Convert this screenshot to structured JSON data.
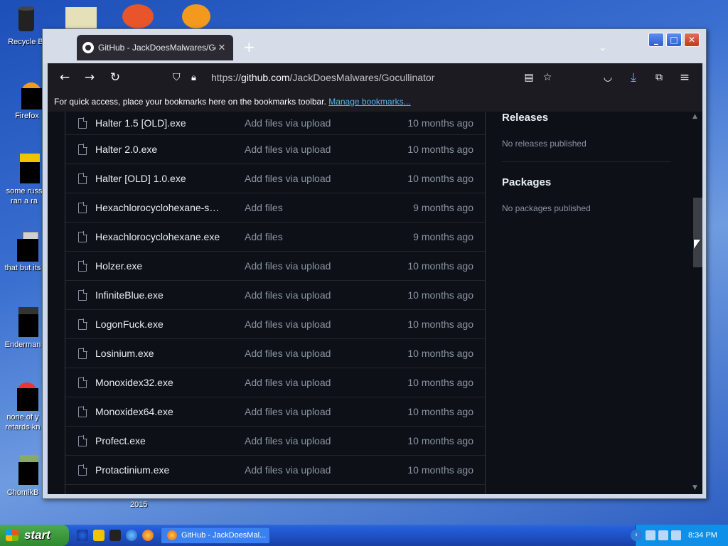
{
  "desktop": {
    "icons": [
      {
        "name": "recycle-bin",
        "label": "Recycle B"
      },
      {
        "name": "firefox",
        "label": "Firefox"
      },
      {
        "name": "some-russ",
        "label": "some russ\nran a ra"
      },
      {
        "name": "that-but-its",
        "label": "that but its"
      },
      {
        "name": "enderman",
        "label": "Enderman"
      },
      {
        "name": "none-of",
        "label": "none of y\nretards kn"
      },
      {
        "name": "chomik",
        "label": "ChomikB"
      }
    ],
    "year_label": "2015"
  },
  "browser": {
    "tab_title": "GitHub - JackDoesMalwares/Gocullinator",
    "tab_close": "✕",
    "new_tab": "+",
    "url_prefix": "https://",
    "url_host": "github.com",
    "url_path": "/JackDoesMalwares/Gocullinator",
    "bookmarks_text": "For quick access, place your bookmarks here on the bookmarks toolbar.",
    "bookmarks_link": "Manage bookmarks..."
  },
  "repo": {
    "files": [
      {
        "name": "Halter 1.5 [OLD].exe",
        "message": "Add files via upload",
        "date": "10 months ago"
      },
      {
        "name": "Halter 2.0.exe",
        "message": "Add files via upload",
        "date": "10 months ago"
      },
      {
        "name": "Halter [OLD] 1.0.exe",
        "message": "Add files via upload",
        "date": "10 months ago"
      },
      {
        "name": "Hexachlorocyclohexane-saf...",
        "message": "Add files",
        "date": "9 months ago"
      },
      {
        "name": "Hexachlorocyclohexane.exe",
        "message": "Add files",
        "date": "9 months ago"
      },
      {
        "name": "Holzer.exe",
        "message": "Add files via upload",
        "date": "10 months ago"
      },
      {
        "name": "InfiniteBlue.exe",
        "message": "Add files via upload",
        "date": "10 months ago"
      },
      {
        "name": "LogonFuck.exe",
        "message": "Add files via upload",
        "date": "10 months ago"
      },
      {
        "name": "Losinium.exe",
        "message": "Add files via upload",
        "date": "10 months ago"
      },
      {
        "name": "Monoxidex32.exe",
        "message": "Add files via upload",
        "date": "10 months ago"
      },
      {
        "name": "Monoxidex64.exe",
        "message": "Add files via upload",
        "date": "10 months ago"
      },
      {
        "name": "Profect.exe",
        "message": "Add files via upload",
        "date": "10 months ago"
      },
      {
        "name": "Protactinium.exe",
        "message": "Add files via upload",
        "date": "10 months ago"
      }
    ],
    "sidebar": {
      "releases_title": "Releases",
      "releases_text": "No releases published",
      "packages_title": "Packages",
      "packages_text": "No packages published"
    }
  },
  "taskbar": {
    "start_label": "start",
    "task_label": "GitHub - JackDoesMal...",
    "clock": "8:34 PM"
  }
}
